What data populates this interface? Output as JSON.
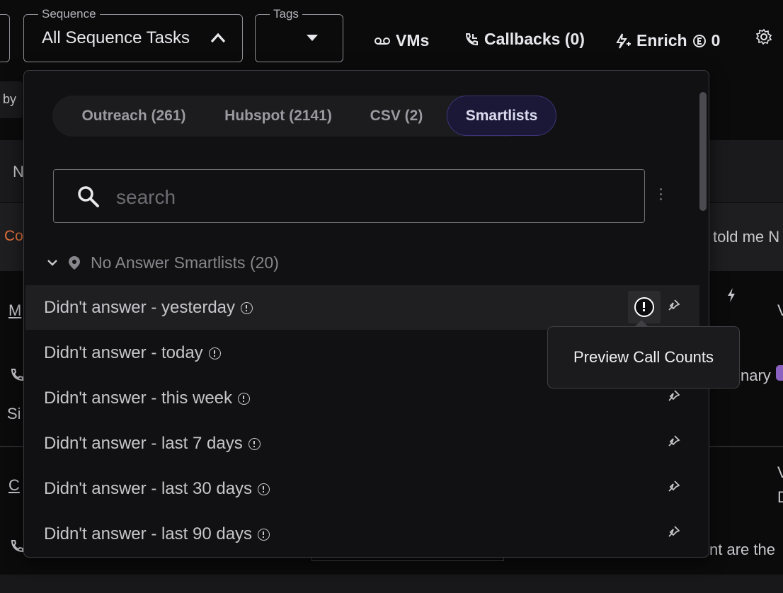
{
  "toolbar": {
    "sequence_legend": "Sequence",
    "sequence_value": "All Sequence Tasks",
    "tags_legend": "Tags",
    "vms_label": "VMs",
    "callbacks_label": "Callbacks (0)",
    "enrich_label": "Enrich",
    "enrich_count": "0"
  },
  "background": {
    "by_label": "by",
    "partial_n": "N",
    "partial_co": "Co",
    "partial_m": "M",
    "partial_si": "Si",
    "partial_c": "C",
    "told_me": "told me N",
    "summary_partial": "nary",
    "nt_are_the": "nt are the"
  },
  "dropdown": {
    "tabs": [
      {
        "label": "Outreach (261)",
        "active": false
      },
      {
        "label": "Hubspot (2141)",
        "active": false
      },
      {
        "label": "CSV (2)",
        "active": false
      },
      {
        "label": "Smartlists",
        "active": true
      }
    ],
    "search": {
      "placeholder": "search",
      "value": ""
    },
    "group": {
      "label": "No Answer Smartlists (20)",
      "expanded": true
    },
    "items": [
      {
        "label": "Didn't answer - yesterday"
      },
      {
        "label": "Didn't answer - today"
      },
      {
        "label": "Didn't answer - this week"
      },
      {
        "label": "Didn't answer - last 7 days"
      },
      {
        "label": "Didn't answer - last 30 days"
      },
      {
        "label": "Didn't answer - last 90 days"
      }
    ]
  },
  "tooltip": {
    "text": "Preview Call Counts"
  },
  "colors": {
    "accent_tab_bg": "#1a1836",
    "accent_tab_border": "#3a3576",
    "background": "#0b0b0c"
  }
}
